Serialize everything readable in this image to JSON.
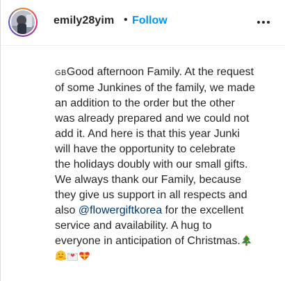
{
  "post": {
    "username": "emily28yim",
    "separator": "•",
    "follow_label": "Follow",
    "more_icon": "more-options-icon"
  },
  "caption": {
    "line1_flag": "GB",
    "line1_text": "Good afternoon Family. At the request",
    "line2": "of some Junkines of the family, we made",
    "line3": "an addition to the order but the other",
    "line4": "was already prepared and we could not",
    "line5": "add it. And here is that this year Junki",
    "line6": "will have the opportunity to celebrate",
    "line7": "the holidays doubly with our small gifts.",
    "line8": "We always thank our Family, because",
    "line9": "they give us support in all respects and",
    "line10_pre": "also ",
    "line10_mention": "@flowergiftkorea",
    "line10_post": " for the excellent",
    "line11": "service and availability. A hug to",
    "line12": "everyone in anticipation of Christmas.",
    "emojis": [
      "christmas-tree",
      "hugging-face",
      "envelope-with-heart",
      "heart-with-ribbon"
    ]
  },
  "colors": {
    "link": "#0095f6",
    "mention": "#00376b",
    "text": "#262626"
  }
}
